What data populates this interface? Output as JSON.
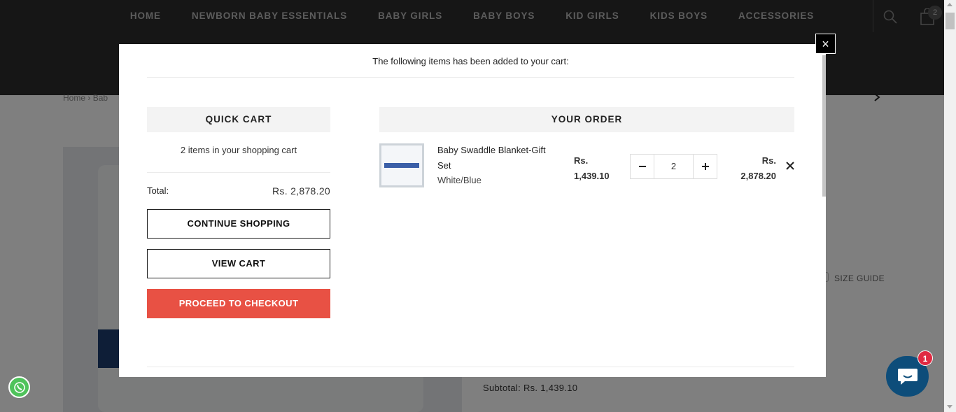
{
  "nav": {
    "items": [
      "HOME",
      "NEWBORN BABY ESSENTIALS",
      "BABY GIRLS",
      "BABY BOYS",
      "KID GIRLS",
      "KIDS BOYS",
      "ACCESSORIES"
    ],
    "cart_count": "2"
  },
  "breadcrumb": {
    "home": "Home",
    "sep": "›",
    "current": "Bab"
  },
  "product_page": {
    "size_guide": "SIZE GUIDE",
    "subtotal_label": "Subtotal:",
    "subtotal_value": "Rs. 1,439.10"
  },
  "chat": {
    "badge": "1"
  },
  "modal": {
    "message": "The following items has been added to your cart:",
    "close": "×",
    "quick_cart": {
      "title": "QUICK CART",
      "count_text": "2 items in your shopping cart",
      "total_label": "Total:",
      "total_value": "Rs. 2,878.20",
      "continue_label": "CONTINUE SHOPPING",
      "view_cart_label": "VIEW CART",
      "checkout_label": "PROCEED TO CHECKOUT"
    },
    "order": {
      "title": "YOUR ORDER",
      "items": [
        {
          "name": "Baby Swaddle Blanket-Gift Set",
          "variant": "White/Blue",
          "price_currency": "Rs.",
          "price_value": "1,439.10",
          "quantity": "2",
          "total_currency": "Rs.",
          "total_value": "2,878.20"
        }
      ]
    }
  },
  "colors": {
    "header_bg": "#2d2d2d",
    "checkout_btn": "#e85144",
    "chat_btn": "#0d4d7a",
    "whatsapp": "#4fc35b",
    "badge": "#e02a42"
  }
}
